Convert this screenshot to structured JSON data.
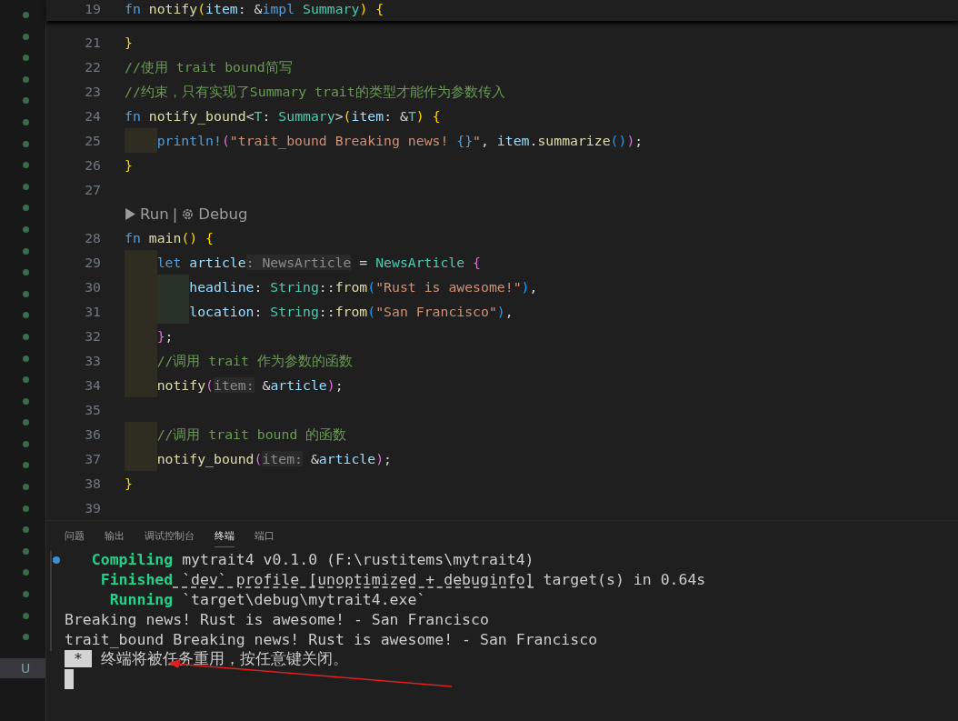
{
  "editor": {
    "sticky_line": {
      "number": "19",
      "tokens": [
        {
          "kind": "kw",
          "text": "fn "
        },
        {
          "kind": "fn",
          "text": "notify"
        },
        {
          "kind": "b1",
          "text": "("
        },
        {
          "kind": "var",
          "text": "item"
        },
        {
          "kind": "plain",
          "text": ": &"
        },
        {
          "kind": "kw",
          "text": "impl "
        },
        {
          "kind": "type",
          "text": "Summary"
        },
        {
          "kind": "b1",
          "text": ") {"
        }
      ]
    },
    "lines_before_lens": [
      {
        "number": "21",
        "tokens": [
          {
            "kind": "b1",
            "text": "}"
          }
        ]
      },
      {
        "number": "22",
        "tokens": [
          {
            "kind": "comment",
            "text": "//使用 trait bound简写"
          }
        ]
      },
      {
        "number": "23",
        "tokens": [
          {
            "kind": "comment",
            "text": "//约束，只有实现了Summary trait的类型才能作为参数传入"
          }
        ]
      },
      {
        "number": "24",
        "tokens": [
          {
            "kind": "kw",
            "text": "fn "
          },
          {
            "kind": "fn",
            "text": "notify_bound"
          },
          {
            "kind": "plain",
            "text": "<"
          },
          {
            "kind": "type",
            "text": "T"
          },
          {
            "kind": "plain",
            "text": ": "
          },
          {
            "kind": "type",
            "text": "Summary"
          },
          {
            "kind": "plain",
            "text": ">"
          },
          {
            "kind": "b1",
            "text": "("
          },
          {
            "kind": "var",
            "text": "item"
          },
          {
            "kind": "plain",
            "text": ": &"
          },
          {
            "kind": "type",
            "text": "T"
          },
          {
            "kind": "b1",
            "text": ") {"
          }
        ]
      },
      {
        "number": "25",
        "indent_outer": true,
        "tokens": [
          {
            "kind": "macro",
            "text": "println!"
          },
          {
            "kind": "b2",
            "text": "("
          },
          {
            "kind": "str",
            "text": "\"trait_bound Breaking news! "
          },
          {
            "kind": "kw",
            "text": "{}"
          },
          {
            "kind": "str",
            "text": "\""
          },
          {
            "kind": "plain",
            "text": ", "
          },
          {
            "kind": "var",
            "text": "item"
          },
          {
            "kind": "plain",
            "text": "."
          },
          {
            "kind": "fn",
            "text": "summarize"
          },
          {
            "kind": "b3",
            "text": "()"
          },
          {
            "kind": "b2",
            "text": ")"
          },
          {
            "kind": "plain",
            "text": ";"
          }
        ]
      },
      {
        "number": "26",
        "tokens": [
          {
            "kind": "b1",
            "text": "}"
          }
        ]
      },
      {
        "number": "27"
      }
    ],
    "code_lens": {
      "run": "Run",
      "separator": "|",
      "debug": "Debug"
    },
    "lines_after_lens": [
      {
        "number": "28",
        "tokens": [
          {
            "kind": "kw",
            "text": "fn "
          },
          {
            "kind": "fn",
            "text": "main"
          },
          {
            "kind": "b1",
            "text": "() {"
          }
        ]
      },
      {
        "number": "29",
        "indent_outer": true,
        "tokens": [
          {
            "kind": "kw",
            "text": "let "
          },
          {
            "kind": "var",
            "text": "article"
          },
          {
            "kind": "hint",
            "text": ": NewsArticle"
          },
          {
            "kind": "plain",
            "text": " = "
          },
          {
            "kind": "type",
            "text": "NewsArticle"
          },
          {
            "kind": "b2",
            "text": " {"
          }
        ]
      },
      {
        "number": "30",
        "indent_outer": true,
        "indent_inner": true,
        "tokens": [
          {
            "kind": "var",
            "text": "headline"
          },
          {
            "kind": "plain",
            "text": ": "
          },
          {
            "kind": "type",
            "text": "String"
          },
          {
            "kind": "plain",
            "text": "::"
          },
          {
            "kind": "fn",
            "text": "from"
          },
          {
            "kind": "b3",
            "text": "("
          },
          {
            "kind": "str",
            "text": "\"Rust is awesome!\""
          },
          {
            "kind": "b3",
            "text": ")"
          },
          {
            "kind": "plain",
            "text": ","
          }
        ]
      },
      {
        "number": "31",
        "indent_outer": true,
        "indent_inner": true,
        "tokens": [
          {
            "kind": "var",
            "text": "location"
          },
          {
            "kind": "plain",
            "text": ": "
          },
          {
            "kind": "type",
            "text": "String"
          },
          {
            "kind": "plain",
            "text": "::"
          },
          {
            "kind": "fn",
            "text": "from"
          },
          {
            "kind": "b3",
            "text": "("
          },
          {
            "kind": "str",
            "text": "\"San Francisco\""
          },
          {
            "kind": "b3",
            "text": ")"
          },
          {
            "kind": "plain",
            "text": ","
          }
        ]
      },
      {
        "number": "32",
        "indent_outer": true,
        "tokens": [
          {
            "kind": "b2",
            "text": "}"
          },
          {
            "kind": "plain",
            "text": ";"
          }
        ]
      },
      {
        "number": "33",
        "indent_outer": true,
        "tokens": [
          {
            "kind": "comment",
            "text": "//调用 trait 作为参数的函数"
          }
        ]
      },
      {
        "number": "34",
        "indent_outer": true,
        "tokens": [
          {
            "kind": "fn",
            "text": "notify"
          },
          {
            "kind": "b2",
            "text": "("
          },
          {
            "kind": "hint",
            "text": "item:"
          },
          {
            "kind": "plain",
            "text": " &"
          },
          {
            "kind": "var",
            "text": "article"
          },
          {
            "kind": "b2",
            "text": ")"
          },
          {
            "kind": "plain",
            "text": ";"
          }
        ]
      },
      {
        "number": "35"
      },
      {
        "number": "36",
        "indent_outer": true,
        "tokens": [
          {
            "kind": "comment",
            "text": "//调用 trait bound 的函数"
          }
        ]
      },
      {
        "number": "37",
        "indent_outer": true,
        "tokens": [
          {
            "kind": "fn",
            "text": "notify_bound"
          },
          {
            "kind": "b2",
            "text": "("
          },
          {
            "kind": "hint",
            "text": "item:"
          },
          {
            "kind": "plain",
            "text": " &"
          },
          {
            "kind": "var",
            "text": "article"
          },
          {
            "kind": "b2",
            "text": ")"
          },
          {
            "kind": "plain",
            "text": ";"
          }
        ]
      },
      {
        "number": "38",
        "tokens": [
          {
            "kind": "b1",
            "text": "}"
          }
        ]
      },
      {
        "number": "39"
      }
    ]
  },
  "panel": {
    "tabs": [
      {
        "label": "问题",
        "selected": false
      },
      {
        "label": "输出",
        "selected": false
      },
      {
        "label": "调试控制台",
        "selected": false
      },
      {
        "label": "终端",
        "selected": true
      },
      {
        "label": "端口",
        "selected": false
      }
    ],
    "terminal": [
      {
        "tokens": [
          {
            "kind": "status",
            "text": "Compiling"
          },
          {
            "kind": "text",
            "text": " mytrait4 v0.1.0 (F:\\rustitems\\mytrait4)"
          }
        ]
      },
      {
        "tokens": [
          {
            "kind": "status",
            "text": "Finished"
          },
          {
            "kind": "link",
            "text": " `dev` profile [unoptimized + debuginfo]"
          },
          {
            "kind": "text",
            "text": " target(s) in 0.64s"
          }
        ]
      },
      {
        "tokens": [
          {
            "kind": "status",
            "text": "Running"
          },
          {
            "kind": "text",
            "text": " `target\\debug\\mytrait4.exe`"
          }
        ]
      },
      {
        "tokens": [
          {
            "kind": "text",
            "text": "Breaking news! Rust is awesome! - San Francisco"
          }
        ]
      },
      {
        "tokens": [
          {
            "kind": "text",
            "text": "trait_bound Breaking news! Rust is awesome! - San Francisco"
          }
        ]
      },
      {
        "tokens": [
          {
            "kind": "inverse",
            "text": "*"
          },
          {
            "kind": "text",
            "text": " 终端将被任务重用，按任意键关闭。"
          }
        ]
      }
    ]
  },
  "gutter_letter": "U"
}
